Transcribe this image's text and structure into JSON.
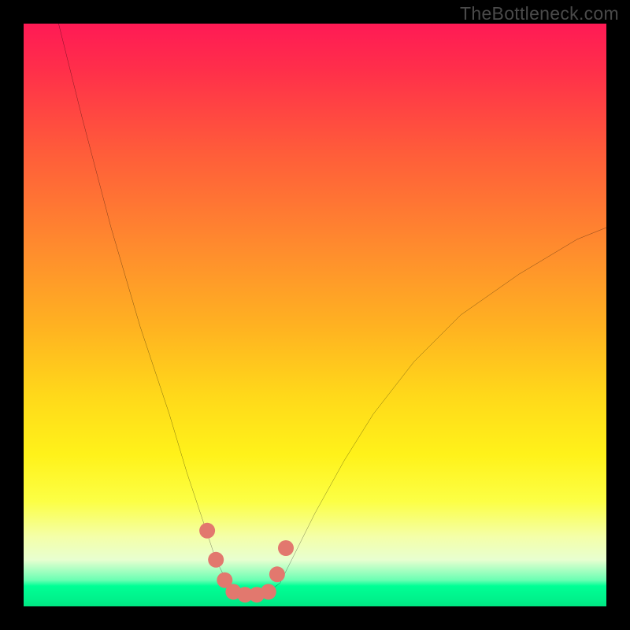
{
  "watermark": "TheBottleneck.com",
  "chart_data": {
    "type": "line",
    "title": "",
    "xlabel": "",
    "ylabel": "",
    "xlim": [
      0,
      100
    ],
    "ylim": [
      0,
      100
    ],
    "series": [
      {
        "name": "bottleneck-curve",
        "x": [
          6,
          10,
          15,
          20,
          25,
          28,
          31,
          33,
          35,
          36,
          37,
          38,
          40,
          42,
          44,
          46,
          50,
          55,
          60,
          67,
          75,
          85,
          95,
          100
        ],
        "y": [
          100,
          84,
          65,
          48,
          33,
          23,
          14,
          8,
          4,
          2.5,
          2,
          2,
          2,
          2.5,
          4,
          8,
          16,
          25,
          33,
          42,
          50,
          57,
          63,
          65
        ]
      }
    ],
    "markers": {
      "name": "highlight-points",
      "color": "#e2786e",
      "x": [
        31.5,
        33,
        34.5,
        36,
        38,
        40,
        42,
        43.5,
        45
      ],
      "y": [
        13,
        8,
        4.5,
        2.5,
        2,
        2,
        2.5,
        5.5,
        10
      ]
    },
    "background_gradient": {
      "top": "#ff1a55",
      "middle": "#ffe61a",
      "bottom": "#00f08a"
    }
  }
}
